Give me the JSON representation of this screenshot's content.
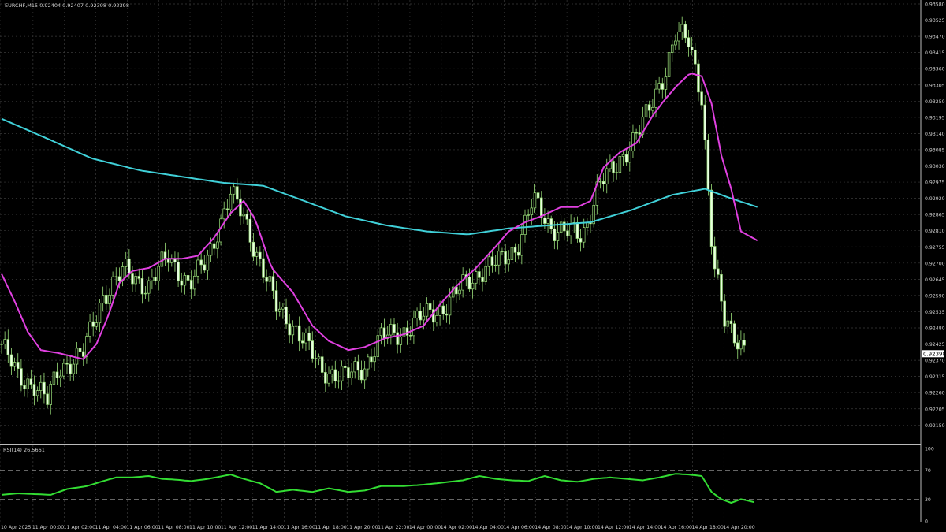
{
  "header": {
    "symbol_info": "EURCHF,M15  0.92404 0.92407 0.92398 0.92398",
    "rsi_info": "RSI(14) 26.5661"
  },
  "current_price_label": "0.92398",
  "colors": {
    "background": "#000000",
    "grid": "#3a3a3a",
    "candle": "#9be07a",
    "ma_fast": "#e040e0",
    "ma_slow": "#40d0d8",
    "rsi_line": "#33dd33",
    "text": "#d0d0d0",
    "separator": "#bbbbbb",
    "price_tag_bg": "#ffffff",
    "price_tag_text": "#000000"
  },
  "chart_data": {
    "type": "line",
    "price_axis": {
      "ylim": [
        0.9211,
        0.9355
      ],
      "ticks": [
        "0.93580",
        "0.93525",
        "0.93470",
        "0.93415",
        "0.93360",
        "0.93305",
        "0.93250",
        "0.93195",
        "0.93140",
        "0.93085",
        "0.93030",
        "0.92975",
        "0.92920",
        "0.92865",
        "0.92810",
        "0.92755",
        "0.92700",
        "0.92645",
        "0.92590",
        "0.92535",
        "0.92480",
        "0.92425",
        "0.92370",
        "0.92315",
        "0.92260",
        "0.92205",
        "0.92150"
      ],
      "current_price": 0.92398
    },
    "rsi_axis": {
      "ylim": [
        0,
        100
      ],
      "ticks": [
        "100",
        "70",
        "30",
        "0"
      ],
      "levels": [
        70,
        30
      ]
    },
    "time_axis": {
      "labels": [
        "10 Apr 2025",
        "11 Apr 00:00",
        "11 Apr 02:00",
        "11 Apr 04:00",
        "11 Apr 06:00",
        "11 Apr 08:00",
        "11 Apr 10:00",
        "11 Apr 12:00",
        "11 Apr 14:00",
        "11 Apr 16:00",
        "11 Apr 18:00",
        "11 Apr 20:00",
        "11 Apr 22:00",
        "14 Apr 00:00",
        "14 Apr 02:00",
        "14 Apr 04:00",
        "14 Apr 06:00",
        "14 Apr 08:00",
        "14 Apr 10:00",
        "14 Apr 12:00",
        "14 Apr 14:00",
        "14 Apr 16:00",
        "14 Apr 18:00",
        "14 Apr 20:00"
      ],
      "bars_per_label": 8,
      "total_bars": 228
    },
    "price_keypoints": [
      [
        0,
        0.9243
      ],
      [
        10,
        0.9232
      ],
      [
        20,
        0.923
      ],
      [
        28,
        0.9224
      ],
      [
        35,
        0.9235
      ],
      [
        50,
        0.924
      ],
      [
        62,
        0.9259
      ],
      [
        75,
        0.9267
      ],
      [
        90,
        0.9262
      ],
      [
        102,
        0.9272
      ],
      [
        115,
        0.9262
      ],
      [
        125,
        0.927
      ],
      [
        133,
        0.9282
      ],
      [
        140,
        0.9292
      ],
      [
        148,
        0.9285
      ],
      [
        158,
        0.927
      ],
      [
        168,
        0.9255
      ],
      [
        180,
        0.9248
      ],
      [
        195,
        0.9235
      ],
      [
        210,
        0.9232
      ],
      [
        222,
        0.9236
      ],
      [
        232,
        0.9245
      ],
      [
        245,
        0.9247
      ],
      [
        258,
        0.9252
      ],
      [
        270,
        0.9255
      ],
      [
        282,
        0.9262
      ],
      [
        295,
        0.9268
      ],
      [
        305,
        0.927
      ],
      [
        315,
        0.9275
      ],
      [
        325,
        0.929
      ],
      [
        335,
        0.9282
      ],
      [
        345,
        0.928
      ],
      [
        355,
        0.9278
      ],
      [
        365,
        0.9296
      ],
      [
        375,
        0.93
      ],
      [
        385,
        0.931
      ],
      [
        395,
        0.9318
      ],
      [
        405,
        0.9332
      ],
      [
        412,
        0.9345
      ],
      [
        420,
        0.9342
      ],
      [
        428,
        0.9325
      ],
      [
        435,
        0.927
      ],
      [
        442,
        0.925
      ],
      [
        450,
        0.9245
      ],
      [
        458,
        0.924
      ]
    ],
    "ma_fast_points": [
      [
        0,
        0.9266
      ],
      [
        8,
        0.9257
      ],
      [
        16,
        0.9247
      ],
      [
        24,
        0.9241
      ],
      [
        35,
        0.924
      ],
      [
        50,
        0.9238
      ],
      [
        58,
        0.9243
      ],
      [
        65,
        0.9252
      ],
      [
        72,
        0.9263
      ],
      [
        80,
        0.9267
      ],
      [
        90,
        0.9268
      ],
      [
        100,
        0.9271
      ],
      [
        110,
        0.9271
      ],
      [
        120,
        0.9272
      ],
      [
        130,
        0.9278
      ],
      [
        140,
        0.9286
      ],
      [
        148,
        0.929
      ],
      [
        155,
        0.9284
      ],
      [
        165,
        0.9268
      ],
      [
        178,
        0.926
      ],
      [
        190,
        0.9249
      ],
      [
        200,
        0.9244
      ],
      [
        212,
        0.9241
      ],
      [
        222,
        0.9242
      ],
      [
        235,
        0.9245
      ],
      [
        245,
        0.9246
      ],
      [
        258,
        0.9249
      ],
      [
        268,
        0.9256
      ],
      [
        278,
        0.9262
      ],
      [
        290,
        0.9268
      ],
      [
        302,
        0.9275
      ],
      [
        310,
        0.928
      ],
      [
        320,
        0.9283
      ],
      [
        330,
        0.9285
      ],
      [
        342,
        0.9288
      ],
      [
        352,
        0.9288
      ],
      [
        360,
        0.929
      ],
      [
        368,
        0.9301
      ],
      [
        378,
        0.9306
      ],
      [
        388,
        0.9309
      ],
      [
        398,
        0.9318
      ],
      [
        405,
        0.9323
      ],
      [
        413,
        0.9328
      ],
      [
        421,
        0.9332
      ],
      [
        428,
        0.9331
      ],
      [
        434,
        0.9322
      ],
      [
        440,
        0.9305
      ],
      [
        446,
        0.9294
      ],
      [
        452,
        0.928
      ],
      [
        462,
        0.9277
      ]
    ],
    "ma_slow_points": [
      [
        0,
        0.9317
      ],
      [
        30,
        0.931
      ],
      [
        55,
        0.9304
      ],
      [
        85,
        0.93
      ],
      [
        110,
        0.9298
      ],
      [
        135,
        0.9296
      ],
      [
        160,
        0.9295
      ],
      [
        185,
        0.929
      ],
      [
        210,
        0.9285
      ],
      [
        235,
        0.9282
      ],
      [
        260,
        0.928
      ],
      [
        285,
        0.9279
      ],
      [
        310,
        0.9281
      ],
      [
        335,
        0.9282
      ],
      [
        360,
        0.9283
      ],
      [
        385,
        0.9287
      ],
      [
        410,
        0.9292
      ],
      [
        430,
        0.9294
      ],
      [
        445,
        0.9291
      ],
      [
        462,
        0.9288
      ]
    ],
    "rsi_points": [
      [
        0,
        36
      ],
      [
        10,
        38
      ],
      [
        20,
        37
      ],
      [
        30,
        36
      ],
      [
        40,
        44
      ],
      [
        52,
        48
      ],
      [
        62,
        55
      ],
      [
        70,
        60
      ],
      [
        80,
        60
      ],
      [
        90,
        62
      ],
      [
        98,
        58
      ],
      [
        106,
        57
      ],
      [
        116,
        55
      ],
      [
        126,
        58
      ],
      [
        140,
        64
      ],
      [
        148,
        58
      ],
      [
        158,
        52
      ],
      [
        168,
        40
      ],
      [
        178,
        43
      ],
      [
        190,
        40
      ],
      [
        200,
        45
      ],
      [
        212,
        40
      ],
      [
        222,
        42
      ],
      [
        232,
        48
      ],
      [
        245,
        48
      ],
      [
        258,
        50
      ],
      [
        270,
        53
      ],
      [
        282,
        56
      ],
      [
        292,
        62
      ],
      [
        302,
        58
      ],
      [
        312,
        56
      ],
      [
        322,
        55
      ],
      [
        332,
        62
      ],
      [
        342,
        56
      ],
      [
        352,
        54
      ],
      [
        362,
        58
      ],
      [
        372,
        60
      ],
      [
        382,
        58
      ],
      [
        392,
        56
      ],
      [
        402,
        60
      ],
      [
        412,
        65
      ],
      [
        420,
        64
      ],
      [
        428,
        62
      ],
      [
        434,
        40
      ],
      [
        440,
        30
      ],
      [
        446,
        25
      ],
      [
        452,
        30
      ],
      [
        460,
        26
      ]
    ]
  }
}
